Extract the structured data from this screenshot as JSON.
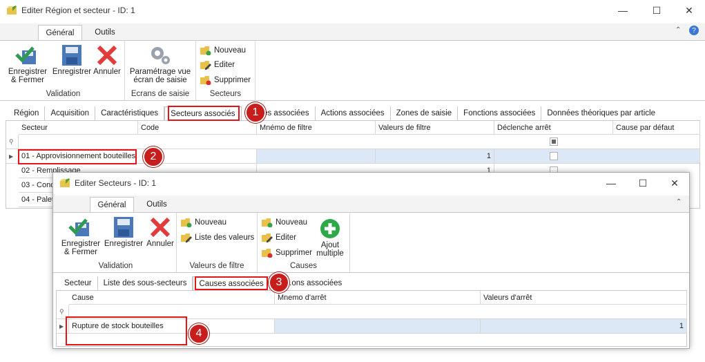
{
  "main_window": {
    "title": "Editer Région et secteur - ID: 1",
    "ribbon_tabs": [
      "Général",
      "Outils"
    ],
    "groups": {
      "validation": {
        "label": "Validation",
        "save_close": "Enregistrer\n& Fermer",
        "save": "Enregistrer",
        "cancel": "Annuler"
      },
      "ecrans": {
        "label": "Ecrans de saisie",
        "param": "Paramétrage vue\nécran de saisie"
      },
      "secteurs": {
        "label": "Secteurs",
        "new": "Nouveau",
        "edit": "Editer",
        "delete": "Supprimer"
      }
    },
    "page_tabs": [
      "Région",
      "Acquisition",
      "Caractéristiques",
      "Secteurs associés",
      "...es associées",
      "Actions associées",
      "Zones de saisie",
      "Fonctions associées",
      "Données théoriques par article"
    ],
    "grid": {
      "columns": [
        "Secteur",
        "Code",
        "Mnémo de filtre",
        "Valeurs de filtre",
        "Déclenche arrêt",
        "Cause par défaut"
      ],
      "rows": [
        {
          "secteur": "01 - Approvisionnement bouteilles",
          "valeurs": "1"
        },
        {
          "secteur": "02 - Remplissage",
          "valeurs": "1"
        },
        {
          "secteur": "03 - Cond",
          "valeurs": ""
        },
        {
          "secteur": "04 - Palet",
          "valeurs": ""
        }
      ]
    }
  },
  "sub_window": {
    "title": "Editer Secteurs - ID: 1",
    "ribbon_tabs": [
      "Général",
      "Outils"
    ],
    "groups": {
      "validation": {
        "label": "Validation",
        "save_close": "Enregistrer\n& Fermer",
        "save": "Enregistrer",
        "cancel": "Annuler"
      },
      "filtre": {
        "label": "Valeurs de filtre",
        "new": "Nouveau",
        "list": "Liste des valeurs"
      },
      "causes": {
        "label": "Causes",
        "new": "Nouveau",
        "edit": "Editer",
        "delete": "Supprimer",
        "bulk": "Ajout\nmultiple"
      }
    },
    "page_tabs": [
      "Secteur",
      "Liste des sous-secteurs",
      "Causes associées",
      "...ons associées"
    ],
    "grid": {
      "columns": [
        "Cause",
        "Mnemo d'arrêt",
        "Valeurs d'arrêt"
      ],
      "rows": [
        {
          "cause": "Rupture de stock bouteilles",
          "valeurs": "1"
        }
      ]
    }
  },
  "badges": [
    "1",
    "2",
    "3",
    "4"
  ],
  "colors": {
    "highlight": "#e0161b",
    "badge": "#c81d1d",
    "selected_row": "#dde8f6"
  }
}
